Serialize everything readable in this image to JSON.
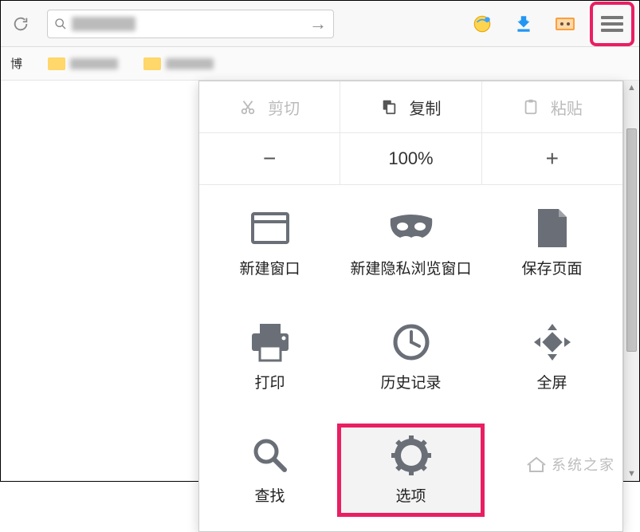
{
  "toolbar": {
    "search_placeholder": "",
    "search_value": ""
  },
  "menu": {
    "edit": {
      "cut": "剪切",
      "copy": "复制",
      "paste": "粘贴"
    },
    "zoom": {
      "minus": "−",
      "level": "100%",
      "plus": "+"
    },
    "grid": {
      "new_window": "新建窗口",
      "private_window": "新建隐私浏览窗口",
      "save_page": "保存页面",
      "print": "打印",
      "history": "历史记录",
      "fullscreen": "全屏",
      "find": "查找",
      "options": "选项"
    }
  },
  "bookmarks": {
    "first_label": "博"
  },
  "watermark": "系统之家"
}
